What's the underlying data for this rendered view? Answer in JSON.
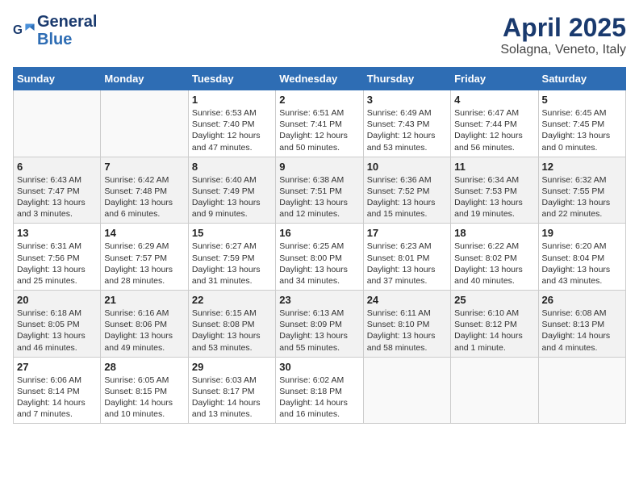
{
  "header": {
    "logo_line1": "General",
    "logo_line2": "Blue",
    "main_title": "April 2025",
    "subtitle": "Solagna, Veneto, Italy"
  },
  "days_of_week": [
    "Sunday",
    "Monday",
    "Tuesday",
    "Wednesday",
    "Thursday",
    "Friday",
    "Saturday"
  ],
  "weeks": [
    [
      {
        "day": "",
        "info": ""
      },
      {
        "day": "",
        "info": ""
      },
      {
        "day": "1",
        "info": "Sunrise: 6:53 AM\nSunset: 7:40 PM\nDaylight: 12 hours and 47 minutes."
      },
      {
        "day": "2",
        "info": "Sunrise: 6:51 AM\nSunset: 7:41 PM\nDaylight: 12 hours and 50 minutes."
      },
      {
        "day": "3",
        "info": "Sunrise: 6:49 AM\nSunset: 7:43 PM\nDaylight: 12 hours and 53 minutes."
      },
      {
        "day": "4",
        "info": "Sunrise: 6:47 AM\nSunset: 7:44 PM\nDaylight: 12 hours and 56 minutes."
      },
      {
        "day": "5",
        "info": "Sunrise: 6:45 AM\nSunset: 7:45 PM\nDaylight: 13 hours and 0 minutes."
      }
    ],
    [
      {
        "day": "6",
        "info": "Sunrise: 6:43 AM\nSunset: 7:47 PM\nDaylight: 13 hours and 3 minutes."
      },
      {
        "day": "7",
        "info": "Sunrise: 6:42 AM\nSunset: 7:48 PM\nDaylight: 13 hours and 6 minutes."
      },
      {
        "day": "8",
        "info": "Sunrise: 6:40 AM\nSunset: 7:49 PM\nDaylight: 13 hours and 9 minutes."
      },
      {
        "day": "9",
        "info": "Sunrise: 6:38 AM\nSunset: 7:51 PM\nDaylight: 13 hours and 12 minutes."
      },
      {
        "day": "10",
        "info": "Sunrise: 6:36 AM\nSunset: 7:52 PM\nDaylight: 13 hours and 15 minutes."
      },
      {
        "day": "11",
        "info": "Sunrise: 6:34 AM\nSunset: 7:53 PM\nDaylight: 13 hours and 19 minutes."
      },
      {
        "day": "12",
        "info": "Sunrise: 6:32 AM\nSunset: 7:55 PM\nDaylight: 13 hours and 22 minutes."
      }
    ],
    [
      {
        "day": "13",
        "info": "Sunrise: 6:31 AM\nSunset: 7:56 PM\nDaylight: 13 hours and 25 minutes."
      },
      {
        "day": "14",
        "info": "Sunrise: 6:29 AM\nSunset: 7:57 PM\nDaylight: 13 hours and 28 minutes."
      },
      {
        "day": "15",
        "info": "Sunrise: 6:27 AM\nSunset: 7:59 PM\nDaylight: 13 hours and 31 minutes."
      },
      {
        "day": "16",
        "info": "Sunrise: 6:25 AM\nSunset: 8:00 PM\nDaylight: 13 hours and 34 minutes."
      },
      {
        "day": "17",
        "info": "Sunrise: 6:23 AM\nSunset: 8:01 PM\nDaylight: 13 hours and 37 minutes."
      },
      {
        "day": "18",
        "info": "Sunrise: 6:22 AM\nSunset: 8:02 PM\nDaylight: 13 hours and 40 minutes."
      },
      {
        "day": "19",
        "info": "Sunrise: 6:20 AM\nSunset: 8:04 PM\nDaylight: 13 hours and 43 minutes."
      }
    ],
    [
      {
        "day": "20",
        "info": "Sunrise: 6:18 AM\nSunset: 8:05 PM\nDaylight: 13 hours and 46 minutes."
      },
      {
        "day": "21",
        "info": "Sunrise: 6:16 AM\nSunset: 8:06 PM\nDaylight: 13 hours and 49 minutes."
      },
      {
        "day": "22",
        "info": "Sunrise: 6:15 AM\nSunset: 8:08 PM\nDaylight: 13 hours and 53 minutes."
      },
      {
        "day": "23",
        "info": "Sunrise: 6:13 AM\nSunset: 8:09 PM\nDaylight: 13 hours and 55 minutes."
      },
      {
        "day": "24",
        "info": "Sunrise: 6:11 AM\nSunset: 8:10 PM\nDaylight: 13 hours and 58 minutes."
      },
      {
        "day": "25",
        "info": "Sunrise: 6:10 AM\nSunset: 8:12 PM\nDaylight: 14 hours and 1 minute."
      },
      {
        "day": "26",
        "info": "Sunrise: 6:08 AM\nSunset: 8:13 PM\nDaylight: 14 hours and 4 minutes."
      }
    ],
    [
      {
        "day": "27",
        "info": "Sunrise: 6:06 AM\nSunset: 8:14 PM\nDaylight: 14 hours and 7 minutes."
      },
      {
        "day": "28",
        "info": "Sunrise: 6:05 AM\nSunset: 8:15 PM\nDaylight: 14 hours and 10 minutes."
      },
      {
        "day": "29",
        "info": "Sunrise: 6:03 AM\nSunset: 8:17 PM\nDaylight: 14 hours and 13 minutes."
      },
      {
        "day": "30",
        "info": "Sunrise: 6:02 AM\nSunset: 8:18 PM\nDaylight: 14 hours and 16 minutes."
      },
      {
        "day": "",
        "info": ""
      },
      {
        "day": "",
        "info": ""
      },
      {
        "day": "",
        "info": ""
      }
    ]
  ]
}
